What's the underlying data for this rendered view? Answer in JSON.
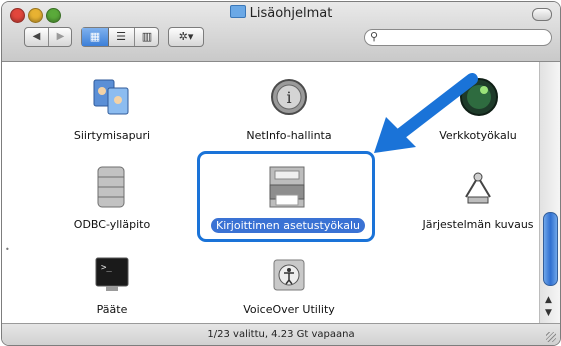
{
  "window": {
    "title": "Lisäohjelmat",
    "status": "1/23 valittu, 4.23 Gt vapaana"
  },
  "toolbar": {
    "back_glyph": "◀",
    "forward_glyph": "▶",
    "view_icons_glyph": "▦",
    "view_list_glyph": "☰",
    "view_columns_glyph": "▥",
    "action_glyph": "✲▾",
    "search_icon_glyph": "⚲",
    "search_value": "",
    "search_placeholder": ""
  },
  "items": [
    {
      "label": "Siirtymisapuri",
      "icon": "migration-assistant-icon"
    },
    {
      "label": "NetInfo-hallinta",
      "icon": "netinfo-icon"
    },
    {
      "label": "Verkkotyökalu",
      "icon": "network-utility-icon"
    },
    {
      "label": "ODBC-ylläpito",
      "icon": "odbc-icon"
    },
    {
      "label": "Kirjoittimen asetustyökalu",
      "icon": "printer-setup-icon",
      "selected": true
    },
    {
      "label": "Järjestelmän kuvaus",
      "icon": "system-profiler-icon"
    },
    {
      "label": "Pääte",
      "icon": "terminal-icon"
    },
    {
      "label": "VoiceOver Utility",
      "icon": "voiceover-icon"
    }
  ],
  "colors": {
    "selection": "#3a72d4",
    "annotation": "#1a73d8"
  }
}
